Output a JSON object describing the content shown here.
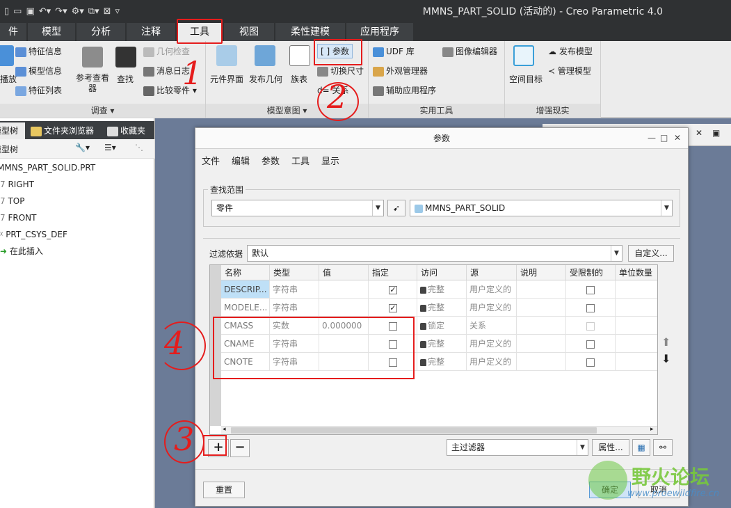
{
  "window": {
    "title": "MMNS_PART_SOLID (活动的) - Creo Parametric 4.0"
  },
  "ribbon_tabs": [
    {
      "label": "件"
    },
    {
      "label": "模型"
    },
    {
      "label": "分析"
    },
    {
      "label": "注释"
    },
    {
      "label": "工具",
      "active": true
    },
    {
      "label": "视图"
    },
    {
      "label": "柔性建模"
    },
    {
      "label": "应用程序"
    }
  ],
  "ribbon": {
    "investigate": {
      "label": "调查",
      "fade_label": "播放",
      "feature_info": "特征信息",
      "model_info": "模型信息",
      "feature_list": "特征列表",
      "ref_viewer": "参考查看器",
      "find": "查找",
      "geom_check": "几何检查",
      "msg_log": "消息日志",
      "compare": "比较零件"
    },
    "model_intent": {
      "label": "模型意图",
      "component_interface": "元件界面",
      "publish_geom": "发布几何",
      "family_table": "族表",
      "parameters": "参数",
      "switch_dims": "切换尺寸",
      "relations": "关系"
    },
    "utilities": {
      "label": "实用工具",
      "udf": "UDF 库",
      "appearance": "外观管理器",
      "aux_app": "辅助应用程序",
      "image_editor": "图像编辑器"
    },
    "ar": {
      "label": "增强现实",
      "spatial_target": "空间目标",
      "publish_model": "发布模型",
      "manage_model": "管理模型"
    }
  },
  "left_panel": {
    "tabs": [
      {
        "label": "模型树"
      },
      {
        "label": "文件夹浏览器"
      },
      {
        "label": "收藏夹"
      }
    ],
    "tree_title": "模型树",
    "items": [
      {
        "label": "MMNS_PART_SOLID.PRT"
      },
      {
        "label": "RIGHT"
      },
      {
        "label": "TOP"
      },
      {
        "label": "FRONT"
      },
      {
        "label": "PRT_CSYS_DEF"
      },
      {
        "label": "在此插入"
      }
    ]
  },
  "dialog": {
    "title": "参数",
    "menu": [
      {
        "label": "文件"
      },
      {
        "label": "编辑"
      },
      {
        "label": "参数"
      },
      {
        "label": "工具"
      },
      {
        "label": "显示"
      }
    ],
    "scope_legend": "查找范围",
    "scope_type": "零件",
    "scope_object": "MMNS_PART_SOLID",
    "filter_label": "过滤依据",
    "filter_value": "默认",
    "customize_button": "自定义...",
    "columns": [
      "名称",
      "类型",
      "值",
      "指定",
      "访问",
      "源",
      "说明",
      "受限制的",
      "单位数量"
    ],
    "rows": [
      {
        "name": "DESCRIP...",
        "type": "字符串",
        "value": "",
        "designate": true,
        "access": "完整",
        "source": "用户定义的",
        "restricted": false
      },
      {
        "name": "MODELE...",
        "type": "字符串",
        "value": "",
        "designate": true,
        "access": "完整",
        "source": "用户定义的",
        "restricted": false
      },
      {
        "name": "CMASS",
        "type": "实数",
        "value": "0.000000",
        "designate": false,
        "access": "锁定",
        "source": "关系",
        "restricted": false
      },
      {
        "name": "CNAME",
        "type": "字符串",
        "value": "",
        "designate": false,
        "access": "完整",
        "source": "用户定义的",
        "restricted": false
      },
      {
        "name": "CNOTE",
        "type": "字符串",
        "value": "",
        "designate": false,
        "access": "完整",
        "source": "用户定义的",
        "restricted": false
      }
    ],
    "add_symbol": "+",
    "remove_symbol": "−",
    "main_filter": "主过滤器",
    "properties_button": "属性...",
    "reset_button": "重置",
    "ok_button": "确定",
    "cancel_button": "取消"
  },
  "annotations": [
    {
      "label": "1"
    },
    {
      "label": "2"
    },
    {
      "label": "3"
    },
    {
      "label": "4"
    }
  ],
  "watermark": {
    "main": "野火论坛",
    "url": "www.proewildfire.cn"
  },
  "colors": {
    "accent_red": "#e51c1c",
    "selection_blue": "#bfe0f7",
    "title_dark": "#2f3133",
    "graphics_bg": "#6b7b97"
  }
}
